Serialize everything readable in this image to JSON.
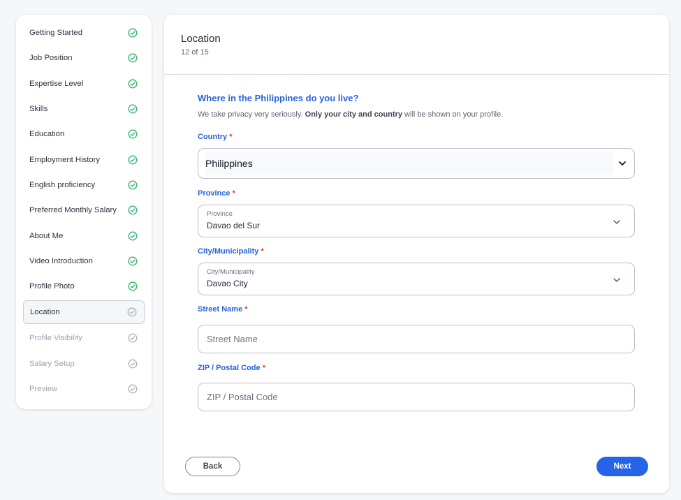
{
  "sidebar": {
    "items": [
      {
        "label": "Getting Started",
        "state": "done"
      },
      {
        "label": "Job Position",
        "state": "done"
      },
      {
        "label": "Expertise Level",
        "state": "done"
      },
      {
        "label": "Skills",
        "state": "done"
      },
      {
        "label": "Education",
        "state": "done"
      },
      {
        "label": "Employment History",
        "state": "done"
      },
      {
        "label": "English proficiency",
        "state": "done"
      },
      {
        "label": "Preferred Monthly Salary",
        "state": "done"
      },
      {
        "label": "About Me",
        "state": "done"
      },
      {
        "label": "Video Introduction",
        "state": "done"
      },
      {
        "label": "Profile Photo",
        "state": "done"
      },
      {
        "label": "Location",
        "state": "active"
      },
      {
        "label": "Profile Visibility",
        "state": "pending"
      },
      {
        "label": "Salary Setup",
        "state": "pending"
      },
      {
        "label": "Preview",
        "state": "pending"
      }
    ]
  },
  "header": {
    "title": "Location",
    "step": "12 of 15"
  },
  "form": {
    "question": "Where in the Philippines do you live?",
    "subtitle_pre": "We take privacy very seriously. ",
    "subtitle_bold": "Only your city and country",
    "subtitle_post": " will be shown on your profile.",
    "country": {
      "label": "Country",
      "value": "Philippines"
    },
    "province": {
      "label": "Province",
      "floating_label": "Province",
      "value": "Davao del Sur"
    },
    "city": {
      "label": "City/Municipality",
      "floating_label": "City/Municipality",
      "value": "Davao City"
    },
    "street": {
      "label": "Street Name",
      "placeholder": "Street Name",
      "value": ""
    },
    "zip": {
      "label": "ZIP / Postal Code",
      "placeholder": "ZIP / Postal Code",
      "value": ""
    },
    "required_mark": "*"
  },
  "buttons": {
    "back": "Back",
    "next": "Next"
  },
  "colors": {
    "accent": "#2563eb",
    "done": "#2fb36a",
    "required": "#e53935"
  }
}
